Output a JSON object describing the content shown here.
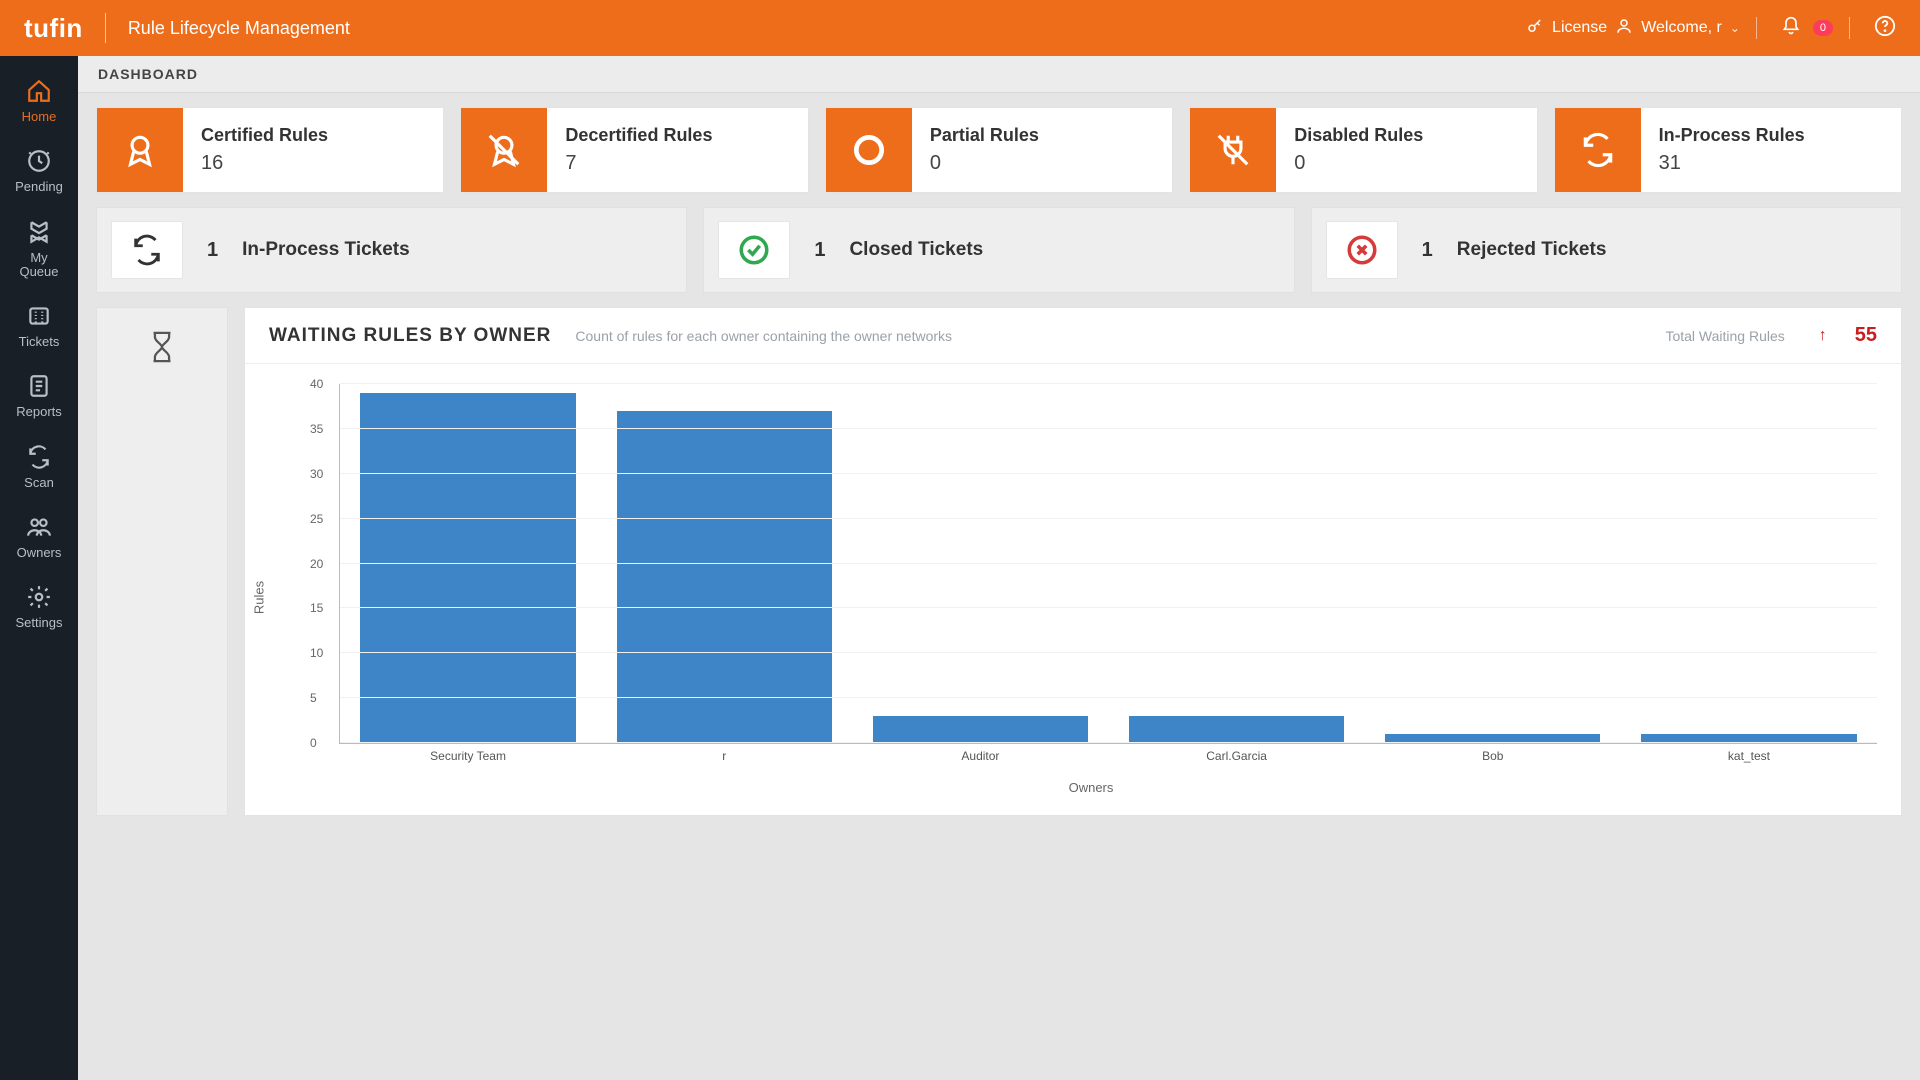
{
  "brand": "tufin",
  "subtitle": "Rule Lifecycle Management",
  "header": {
    "license": "License",
    "welcome_label": "Welcome, r",
    "notif_count": "0"
  },
  "sidebar": [
    {
      "id": "home",
      "label": "Home",
      "active": true
    },
    {
      "id": "pending",
      "label": "Pending",
      "active": false
    },
    {
      "id": "myqueue",
      "label": "My Queue",
      "active": false
    },
    {
      "id": "tickets",
      "label": "Tickets",
      "active": false
    },
    {
      "id": "reports",
      "label": "Reports",
      "active": false
    },
    {
      "id": "scan",
      "label": "Scan",
      "active": false
    },
    {
      "id": "owners",
      "label": "Owners",
      "active": false
    },
    {
      "id": "settings",
      "label": "Settings",
      "active": false
    }
  ],
  "crumb": "DASHBOARD",
  "stat_cards": [
    {
      "label": "Certified Rules",
      "value": "16",
      "icon": "ribbon"
    },
    {
      "label": "Decertified Rules",
      "value": "7",
      "icon": "ribbon-slash"
    },
    {
      "label": "Partial Rules",
      "value": "0",
      "icon": "circle-hollow"
    },
    {
      "label": "Disabled Rules",
      "value": "0",
      "icon": "plug-off"
    },
    {
      "label": "In-Process Rules",
      "value": "31",
      "icon": "refresh"
    }
  ],
  "ticket_cards": [
    {
      "count": "1",
      "label": "In-Process Tickets",
      "icon": "refresh",
      "color": "#333"
    },
    {
      "count": "1",
      "label": "Closed Tickets",
      "icon": "check-circle",
      "color": "#2fa84f"
    },
    {
      "count": "1",
      "label": "Rejected Tickets",
      "icon": "x-circle",
      "color": "#d53b3b"
    }
  ],
  "chart_header": {
    "title": "WAITING RULES BY OWNER",
    "subtitle": "Count of rules for each owner containing the owner networks",
    "total_label": "Total Waiting Rules",
    "total_value": "55"
  },
  "chart_data": {
    "type": "bar",
    "categories": [
      "Security Team",
      "r",
      "Auditor",
      "Carl.Garcia",
      "Bob",
      "kat_test"
    ],
    "values": [
      39,
      37,
      3,
      3,
      1,
      1
    ],
    "title": "WAITING RULES BY OWNER",
    "xlabel": "Owners",
    "ylabel": "Rules",
    "ylim": [
      0,
      40
    ],
    "y_ticks": [
      0,
      5,
      10,
      15,
      20,
      25,
      30,
      35,
      40
    ]
  }
}
